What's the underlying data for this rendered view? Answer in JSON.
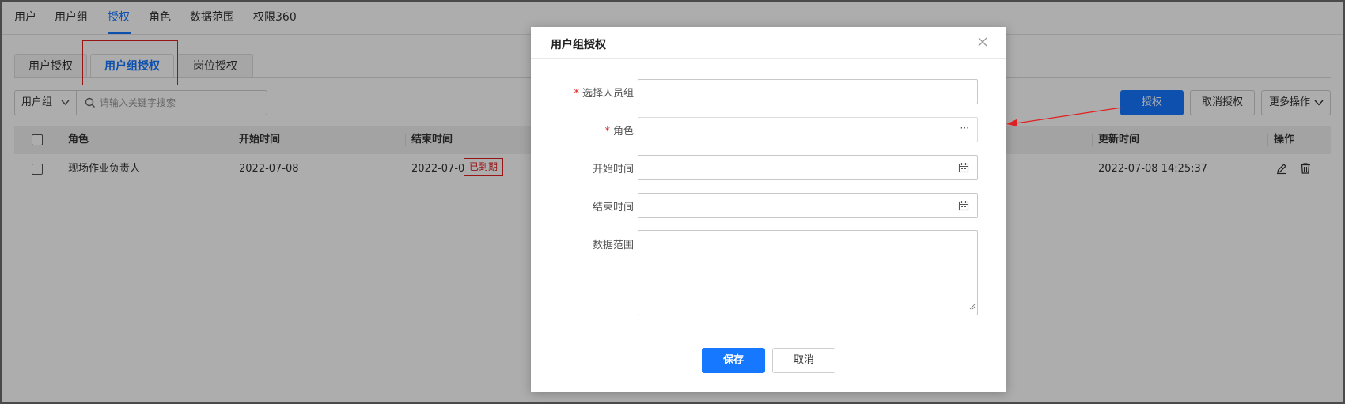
{
  "topnav": {
    "items": [
      "用户",
      "用户组",
      "授权",
      "角色",
      "数据范围",
      "权限360"
    ],
    "active_index": 2
  },
  "subtabs": {
    "items": [
      "用户授权",
      "用户组授权",
      "岗位授权"
    ],
    "active_index": 1
  },
  "search": {
    "select_value": "用户组",
    "placeholder": "请输入关键字搜索"
  },
  "actions": {
    "authorize_label": "授权",
    "cancel_authorize_label": "取消授权",
    "more_label": "更多操作"
  },
  "table": {
    "columns": [
      "角色",
      "开始时间",
      "结束时间",
      "更新时间",
      "操作"
    ],
    "rows": [
      {
        "role": "现场作业负责人",
        "start": "2022-07-08",
        "end": "2022-07-09",
        "status_tag": "已到期",
        "updated": "2022-07-08 14:25:37"
      }
    ]
  },
  "modal": {
    "title": "用户组授权",
    "fields": {
      "group_label": "选择人员组",
      "role_label": "角色",
      "start_label": "开始时间",
      "end_label": "结束时间",
      "scope_label": "数据范围"
    },
    "required_mark": "*",
    "role_trailing": "···",
    "save_label": "保存",
    "cancel_label": "取消"
  },
  "colors": {
    "primary": "#1677ff",
    "danger": "#e02020"
  }
}
